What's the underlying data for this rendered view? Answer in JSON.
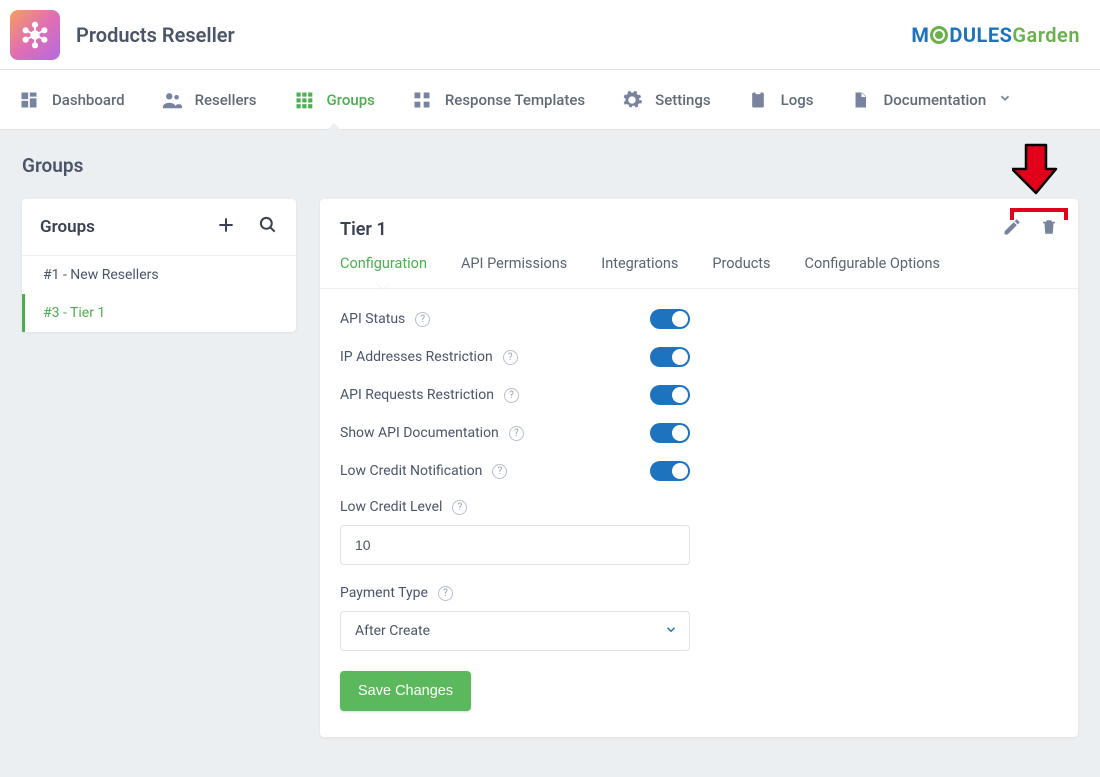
{
  "app_title": "Products Reseller",
  "brand": {
    "part1": "M",
    "part2": "DULES",
    "part3": "Garden"
  },
  "nav": [
    {
      "label": "Dashboard"
    },
    {
      "label": "Resellers"
    },
    {
      "label": "Groups",
      "active": true
    },
    {
      "label": "Response Templates"
    },
    {
      "label": "Settings"
    },
    {
      "label": "Logs"
    },
    {
      "label": "Documentation",
      "dropdown": true
    }
  ],
  "page_title": "Groups",
  "sidebar": {
    "title": "Groups",
    "items": [
      {
        "id": "1",
        "label": "#1 - New Resellers"
      },
      {
        "id": "3",
        "label": "#3 - Tier 1",
        "selected": true
      }
    ]
  },
  "main": {
    "title": "Tier 1",
    "subtabs": [
      {
        "label": "Configuration",
        "active": true
      },
      {
        "label": "API Permissions"
      },
      {
        "label": "Integrations"
      },
      {
        "label": "Products"
      },
      {
        "label": "Configurable Options"
      }
    ],
    "toggles": [
      {
        "label": "API Status",
        "on": true
      },
      {
        "label": "IP Addresses Restriction",
        "on": true
      },
      {
        "label": "API Requests Restriction",
        "on": true
      },
      {
        "label": "Show API Documentation",
        "on": true
      },
      {
        "label": "Low Credit Notification",
        "on": true
      }
    ],
    "low_credit_level_label": "Low Credit Level",
    "low_credit_level_value": "10",
    "payment_type_label": "Payment Type",
    "payment_type_value": "After Create",
    "save_label": "Save Changes"
  }
}
